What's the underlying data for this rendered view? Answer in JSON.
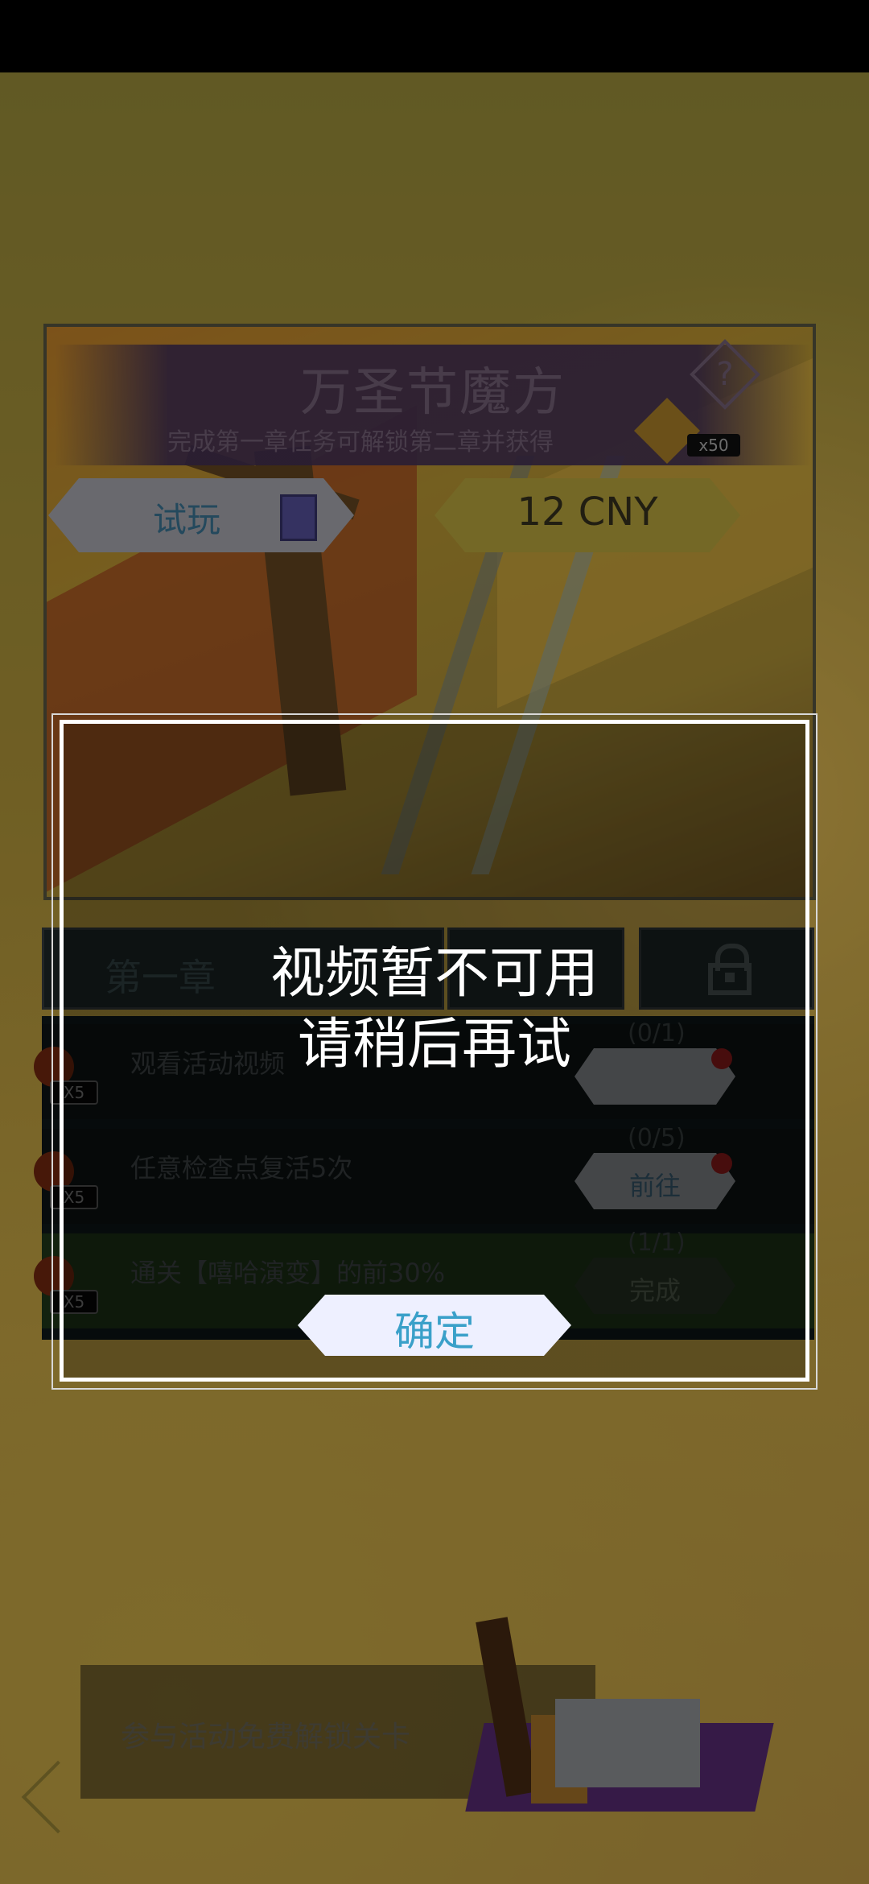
{
  "event_card": {
    "title": "万圣节魔方",
    "subtitle": "完成第一章任务可解锁第二章并获得",
    "reward_count": "x50",
    "trial_label": "试玩",
    "price_label": "12 CNY"
  },
  "chapter_tabs": {
    "current_label": "第一章"
  },
  "tasks": [
    {
      "text": "观看活动视频",
      "count": "(0/1)",
      "reward": "X5"
    },
    {
      "text": "任意检查点复活5次",
      "count": "(0/5)",
      "reward": "X5",
      "button": "前往"
    },
    {
      "text": "通关【嘻哈演变】的前30%",
      "count": "(1/1)",
      "reward": "X5",
      "button": "完成"
    }
  ],
  "banner": {
    "text": "参与活动免费解锁关卡"
  },
  "dialog": {
    "line1": "视频暂不可用",
    "line2": "请稍后再试",
    "ok_label": "确定"
  },
  "icons": {
    "help": "help-icon",
    "lock": "lock-icon",
    "back": "back-arrow-icon",
    "video": "video-icon",
    "pumpkin": "pumpkin-icon"
  },
  "colors": {
    "dialog_border": "#ffffff",
    "ok_button_bg": "#eef0ff",
    "ok_button_text": "#3aa0c9"
  }
}
